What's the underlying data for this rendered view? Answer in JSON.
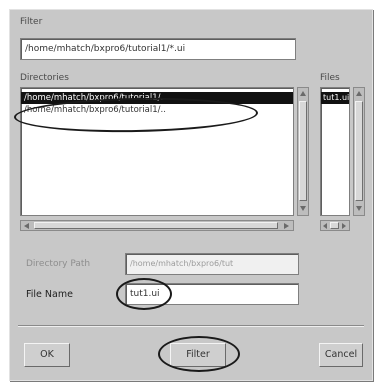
{
  "filter": {
    "label": "Filter",
    "value": "/home/mhatch/bxpro6/tutorial1/*.ui"
  },
  "directories": {
    "label": "Directories",
    "items": [
      "/home/mhatch/bxpro6/tutorial1/.",
      "/home/mhatch/bxpro6/tutorial1/.."
    ],
    "selected_index": 0
  },
  "files": {
    "label": "Files",
    "items": [
      "tut1.ui"
    ],
    "selected_index": 0
  },
  "directory_path": {
    "label": "Directory Path",
    "value": "/home/mhatch/bxpro6/tut"
  },
  "file_name": {
    "label": "File Name",
    "value": "tut1.ui"
  },
  "buttons": {
    "ok": "OK",
    "filter": "Filter",
    "cancel": "Cancel"
  }
}
